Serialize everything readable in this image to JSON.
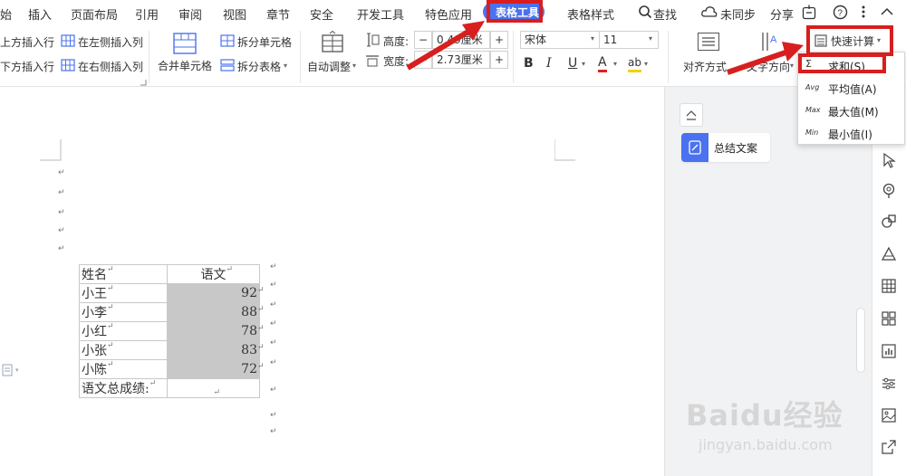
{
  "menu": {
    "items": [
      "始",
      "插入",
      "页面布局",
      "引用",
      "审阅",
      "视图",
      "章节",
      "安全",
      "开发工具",
      "特色应用",
      "表格工具",
      "表格样式"
    ],
    "search": "查找",
    "sync": "未同步",
    "share": "分享"
  },
  "ribbon": {
    "insert_row_above": "上方插入行",
    "insert_row_below": "下方插入行",
    "insert_col_left": "在左侧插入列",
    "insert_col_right": "在右侧插入列",
    "merge_cells": "合并单元格",
    "split_cells": "拆分单元格",
    "split_table": "拆分表格",
    "auto_fit": "自动调整",
    "height_label": "高度:",
    "height_value": "0.49厘米",
    "width_label": "宽度:",
    "width_value": "2.73厘米",
    "font_name": "宋体",
    "font_size": "11",
    "align": "对齐方式",
    "text_direction": "文字方向",
    "quick_calc": "快速计算"
  },
  "dropdown": {
    "items": [
      {
        "tag": "Σ",
        "label": "求和(S)"
      },
      {
        "tag": "Avg",
        "label": "平均值(A)"
      },
      {
        "tag": "Max",
        "label": "最大值(M)"
      },
      {
        "tag": "Min",
        "label": "最小值(I)"
      }
    ]
  },
  "panel": {
    "summary_button": "总结文案"
  },
  "table": {
    "header": [
      "姓名",
      "语文"
    ],
    "rows": [
      [
        "小王",
        "92"
      ],
      [
        "小李",
        "88"
      ],
      [
        "小红",
        "78"
      ],
      [
        "小张",
        "83"
      ],
      [
        "小陈",
        "72"
      ]
    ],
    "total_label": "语文总成绩:"
  },
  "watermark": {
    "brand": "Baidu经验",
    "url": "jingyan.baidu.com"
  },
  "colors": {
    "accent": "#4a72f0",
    "highlight": "#d81e1e",
    "shade": "#c8c8c8"
  }
}
